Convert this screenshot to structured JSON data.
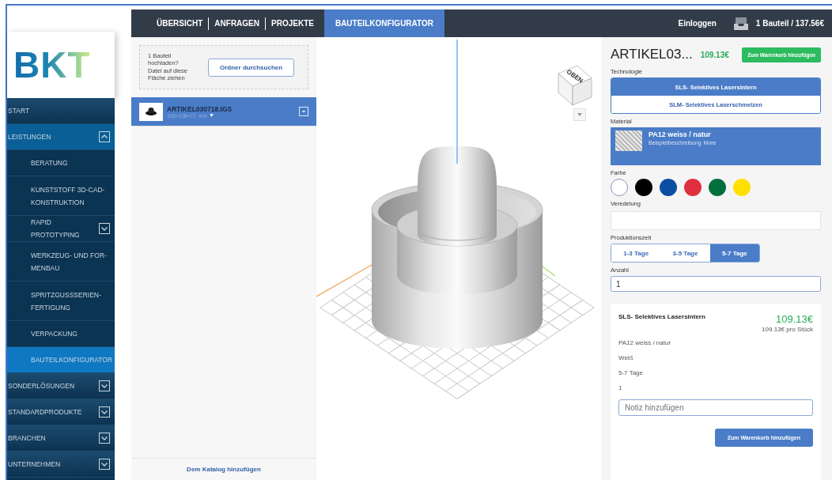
{
  "nav": {
    "tabs": [
      {
        "label": "ÜBERSICHT",
        "selected": false
      },
      {
        "label": "ANFRAGEN",
        "selected": false
      },
      {
        "label": "PROJEKTE",
        "selected": false
      },
      {
        "label": "BAUTEILKONFIGURATOR",
        "selected": true
      }
    ],
    "login": "Einloggen",
    "cart": "1 Bauteil / 137.56€"
  },
  "sidebar": {
    "logo": "BKT",
    "items": [
      {
        "label": "START",
        "kind": "link",
        "selected": false
      },
      {
        "label": "LEISTUNGEN",
        "kind": "group",
        "expanded": true,
        "selected": false,
        "children": [
          {
            "label": "BERATUNG",
            "kind": "link",
            "selected": false
          },
          {
            "label": "KUNSTSTOFF 3D-CAD-KONSTRUKTION",
            "kind": "link",
            "selected": false
          },
          {
            "label": "RAPID PROTOTYPING",
            "kind": "group",
            "expanded": false,
            "selected": false
          },
          {
            "label": "WERKZEUG- UND FOR-MENBAU",
            "kind": "link",
            "selected": false
          },
          {
            "label": "SPRITZGUSSSERIEN-FERTIGUNG",
            "kind": "link",
            "selected": false
          },
          {
            "label": "VERPACKUNG",
            "kind": "link",
            "selected": false
          },
          {
            "label": "BAUTEILKONFIGURATOR",
            "kind": "link",
            "selected": true
          }
        ]
      },
      {
        "label": "SONDERLÖSUNGEN",
        "kind": "group",
        "expanded": false,
        "selected": false
      },
      {
        "label": "STANDARDPRODUKTE",
        "kind": "group",
        "expanded": false,
        "selected": false
      },
      {
        "label": "BRANCHEN",
        "kind": "group",
        "expanded": false,
        "selected": false
      },
      {
        "label": "UNTERNEHMEN",
        "kind": "group",
        "expanded": false,
        "selected": false
      }
    ]
  },
  "upload": {
    "prompt": "1 Bauteil hochladen?",
    "hint": "Datei auf diese Fläche ziehen",
    "button": "Ordner durchsuchen"
  },
  "files": [
    {
      "name": "ARTIKEL030718.IGS",
      "dimensions": "108×108×72  mm",
      "selected": true
    }
  ],
  "catalog_link": "Dem Katalog hinzufügen",
  "viewer": {
    "cube_label": "OBEN"
  },
  "configurator": {
    "title": "ARTIKEL03...",
    "price": "109.13€",
    "cart_button": "Zum Warenkorb hinzufügen",
    "technology": {
      "label": "Technologie",
      "options": [
        {
          "label": "SLS- Selektives Lasersintern",
          "selected": true
        },
        {
          "label": "SLM- Selektives Laserschmelzen",
          "selected": false
        }
      ]
    },
    "material": {
      "label": "Material",
      "name": "PA12 weiss / natur",
      "description": "Beispielbeschreibung",
      "more": "More"
    },
    "color": {
      "label": "Farbe",
      "swatches": [
        {
          "color": "#ffffff",
          "selected": true
        },
        {
          "color": "#000000",
          "selected": false
        },
        {
          "color": "#0b4ea2",
          "selected": false
        },
        {
          "color": "#e03040",
          "selected": false
        },
        {
          "color": "#00703c",
          "selected": false
        },
        {
          "color": "#ffe000",
          "selected": false
        }
      ]
    },
    "finish": {
      "label": "Veredelung"
    },
    "production_time": {
      "label": "Produktionszeit",
      "options": [
        {
          "label": "1-3 Tage",
          "selected": false
        },
        {
          "label": "3-5 Tage",
          "selected": false
        },
        {
          "label": "5-7 Tage",
          "selected": true
        }
      ]
    },
    "quantity": {
      "label": "Anzahl",
      "value": "1"
    }
  },
  "summary": {
    "technology": "SLS- Selektives Lasersintern",
    "price": "109.13€",
    "unit_price": "109.13€ pro Stück",
    "lines": [
      "PA12 weiss / natur",
      "Weiß",
      "5-7 Tage",
      "1"
    ],
    "note": {
      "placeholder": "Notiz hinzufügen"
    },
    "button": "Zum Warenkorb hinzufügen"
  }
}
